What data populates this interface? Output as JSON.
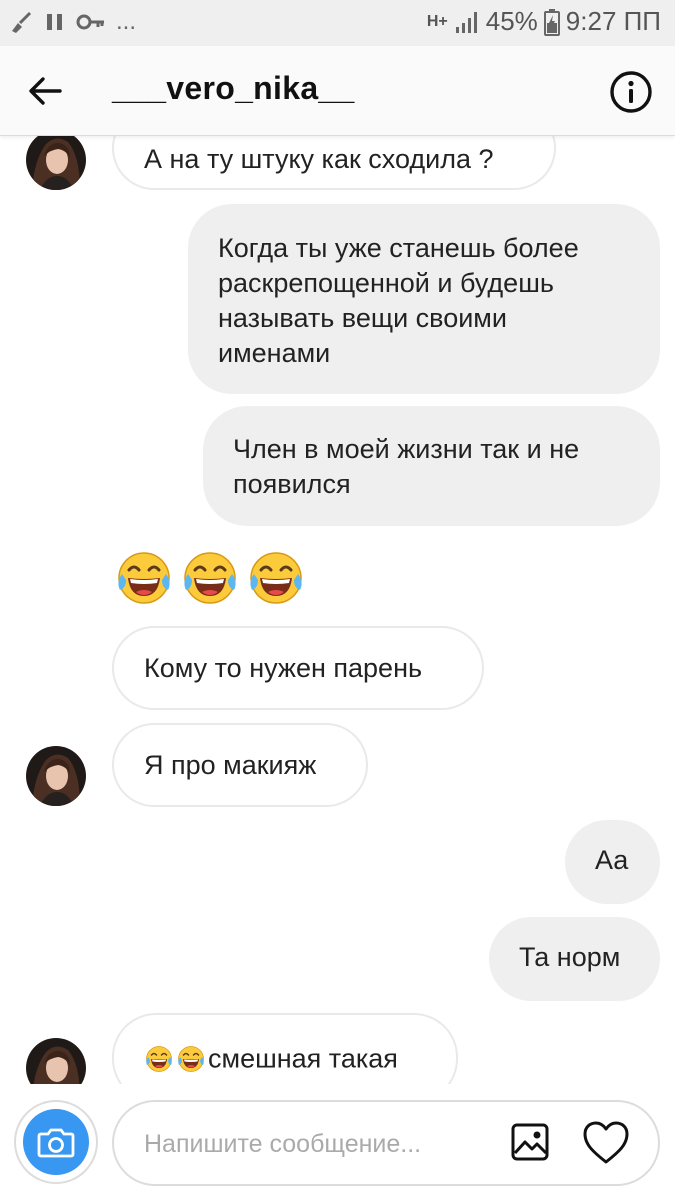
{
  "status_bar": {
    "network_type": "H+",
    "battery": "45%",
    "time": "9:27 ПП",
    "more": "..."
  },
  "header": {
    "title": "___vero_nika__"
  },
  "messages": [
    {
      "direction": "incoming",
      "text": "А на ту штуку как сходила ?",
      "avatar": true
    },
    {
      "direction": "outgoing",
      "lines": [
        "Когда ты уже станешь более",
        "раскрепощенной и будешь",
        "называть вещи своими",
        "именами"
      ]
    },
    {
      "direction": "outgoing",
      "lines": [
        "Член в моей жизни так и не",
        "появился"
      ]
    },
    {
      "direction": "incoming",
      "emoji": [
        "face-with-tears-of-joy",
        "face-with-tears-of-joy",
        "face-with-tears-of-joy"
      ]
    },
    {
      "direction": "incoming",
      "text": "Кому то нужен парень"
    },
    {
      "direction": "incoming",
      "text": "Я про макияж",
      "avatar": true
    },
    {
      "direction": "outgoing",
      "text": "Аа"
    },
    {
      "direction": "outgoing",
      "text": "Та норм"
    },
    {
      "direction": "incoming",
      "text": "смешная такая",
      "emoji_prefix": [
        "face-with-tears-of-joy",
        "face-with-tears-of-joy"
      ],
      "avatar": true
    }
  ],
  "composer": {
    "placeholder": "Напишите сообщение..."
  },
  "icons": {
    "back": "arrow-left-icon",
    "info": "info-icon",
    "camera": "camera-icon",
    "gallery": "gallery-icon",
    "like": "heart-icon"
  },
  "colors": {
    "accent": "#3897f0",
    "outgoing_bubble": "#efefef",
    "incoming_border": "#e9e9e9",
    "status_bar": "#efefef"
  }
}
